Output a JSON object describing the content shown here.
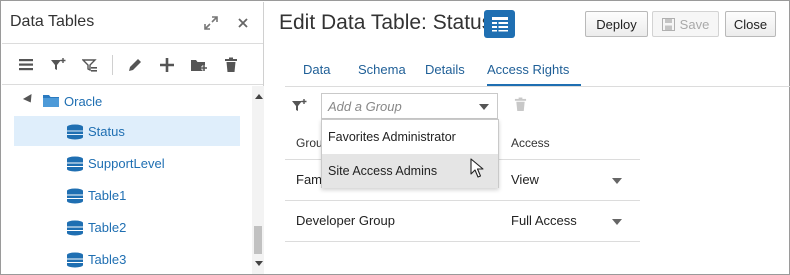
{
  "left_panel": {
    "title": "Data Tables",
    "header_icons": [
      "expand-icon",
      "close-icon"
    ],
    "toolbar_icons": [
      "list-icon",
      "filter-add-icon",
      "filter-edit-icon",
      "edit-icon",
      "add-icon",
      "new-folder-icon",
      "delete-icon"
    ],
    "tree": {
      "folder": "Oracle",
      "items": [
        "Status",
        "SupportLevel",
        "Table1",
        "Table2",
        "Table3"
      ],
      "selected": "Status"
    }
  },
  "main": {
    "title": "Edit Data Table: Status",
    "buttons": {
      "deploy": "Deploy",
      "save": "Save",
      "close": "Close"
    },
    "tabs": [
      "Data",
      "Schema",
      "Details",
      "Access Rights"
    ],
    "active_tab": "Access Rights",
    "group_select": {
      "placeholder": "Add a Group"
    },
    "dropdown_options": [
      "Favorites Administrator",
      "Site Access Admins"
    ],
    "hovered_option": "Site Access Admins",
    "table": {
      "headers": [
        "Grou",
        "Access"
      ],
      "rows": [
        {
          "group": "Fam",
          "access": "View"
        },
        {
          "group": "Developer Group",
          "access": "Full Access"
        }
      ]
    }
  },
  "colors": {
    "accent": "#1f6fb2",
    "selected_row": "#dfeefb",
    "tab_text": "#1f5f97"
  }
}
